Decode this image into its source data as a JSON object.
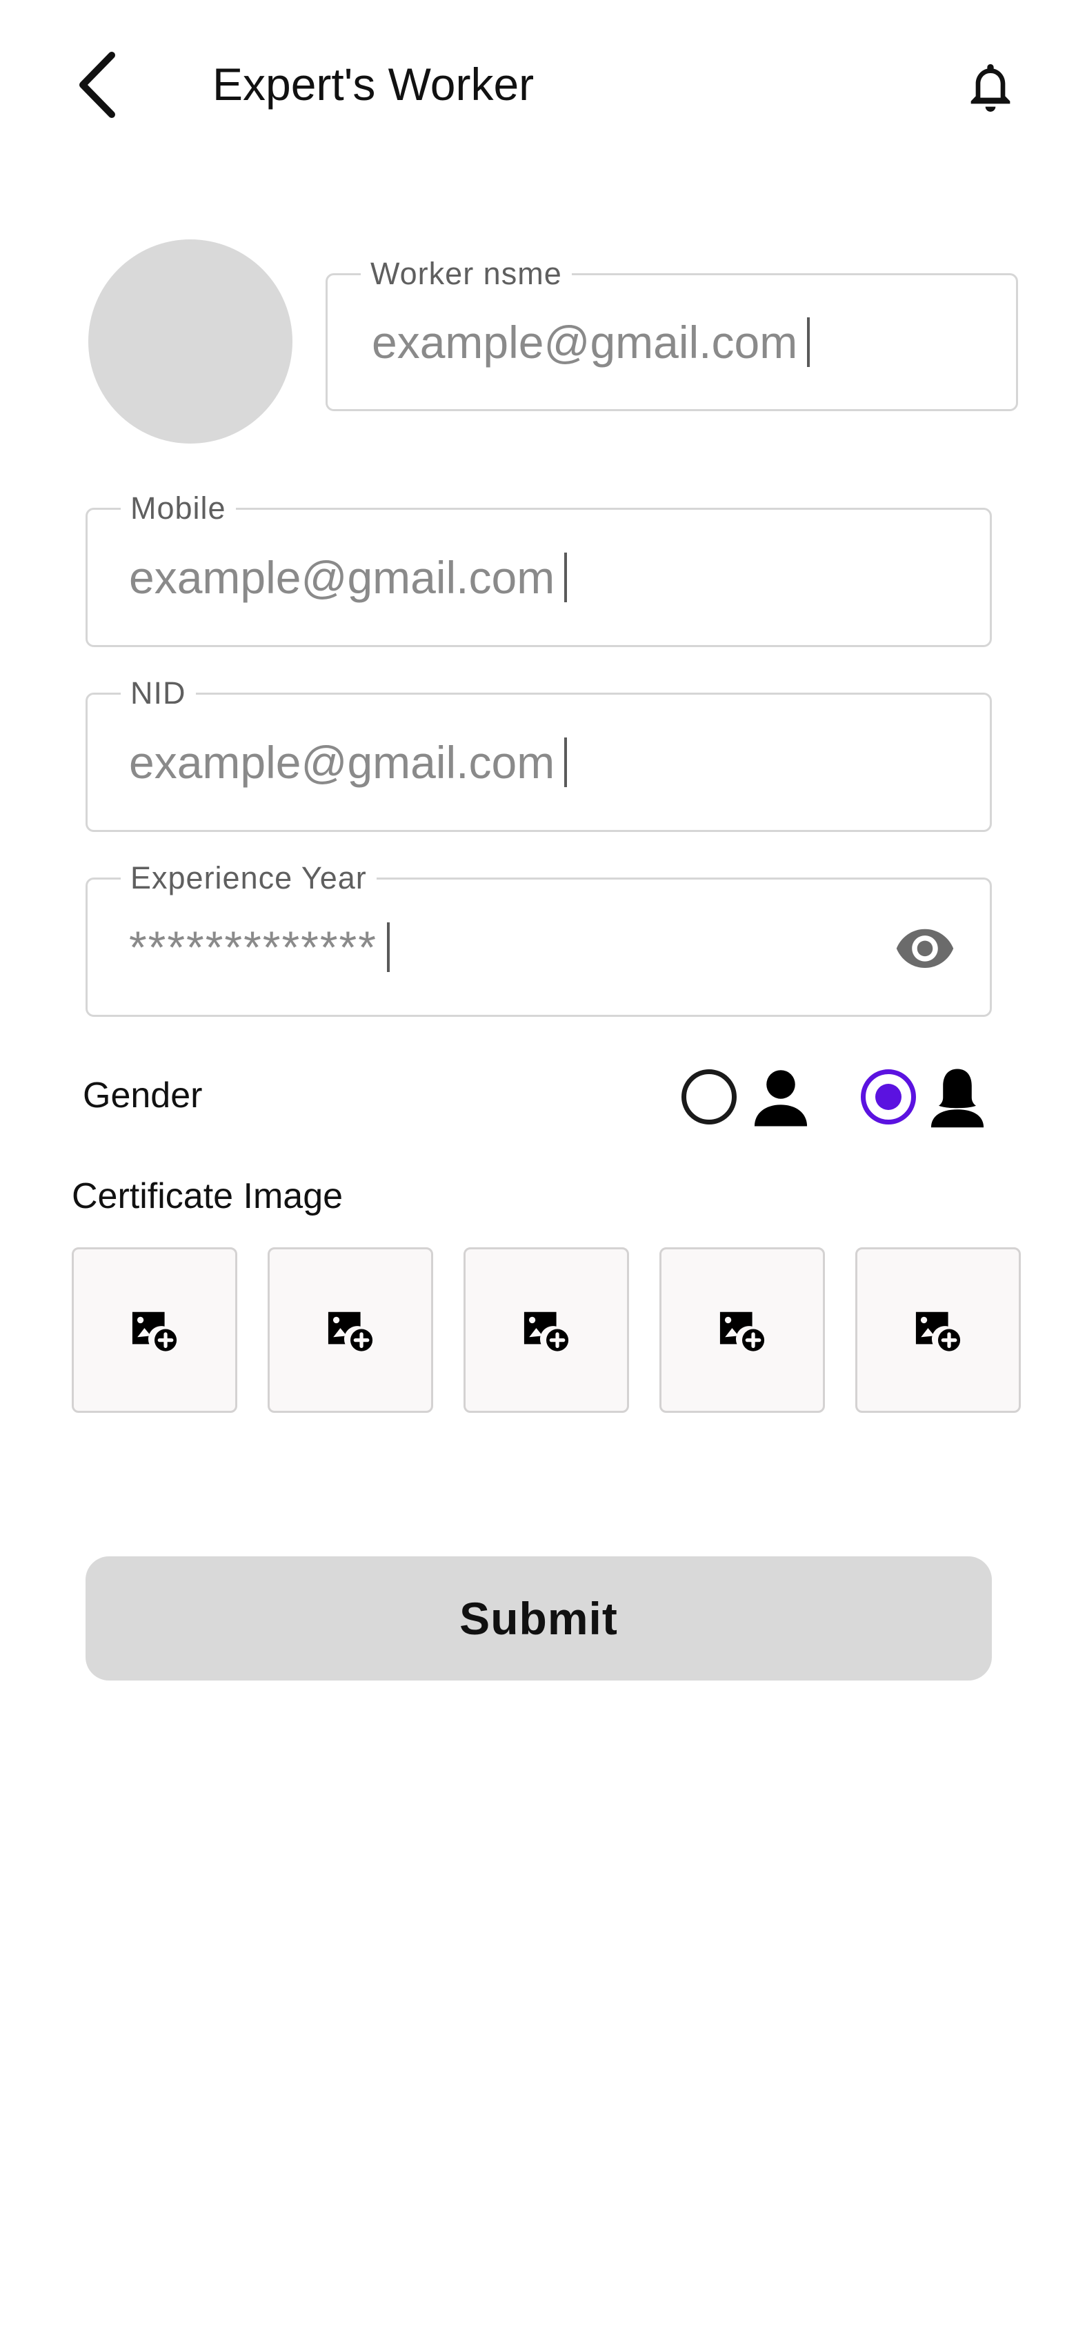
{
  "header": {
    "title": "Expert's Worker",
    "back_icon": "chevron-left-icon",
    "notification_icon": "bell-icon"
  },
  "profile": {
    "avatar": "avatar-placeholder"
  },
  "form": {
    "worker_name": {
      "label": "Worker nsme",
      "value": "example@gmail.com"
    },
    "mobile": {
      "label": "Mobile",
      "value": "example@gmail.com"
    },
    "nid": {
      "label": "NID",
      "value": "example@gmail.com"
    },
    "experience_year": {
      "label": "Experience Year",
      "value": "*************",
      "toggle_icon": "eye-icon"
    }
  },
  "gender": {
    "label": "Gender",
    "options": [
      {
        "value": "male",
        "icon": "male-person-icon",
        "selected": false
      },
      {
        "value": "female",
        "icon": "female-person-icon",
        "selected": true
      }
    ],
    "accent_color": "#5B12E0"
  },
  "certificate": {
    "label": "Certificate Image",
    "slots": [
      {
        "icon": "add-photo-icon"
      },
      {
        "icon": "add-photo-icon"
      },
      {
        "icon": "add-photo-icon"
      },
      {
        "icon": "add-photo-icon"
      },
      {
        "icon": "add-photo-icon"
      }
    ]
  },
  "submit": {
    "label": "Submit"
  },
  "colors": {
    "field_border": "#D6D6D6",
    "placeholder_text": "#8A8A8A",
    "button_bg": "#D9D9D9",
    "avatar_bg": "#D9D9D9"
  }
}
